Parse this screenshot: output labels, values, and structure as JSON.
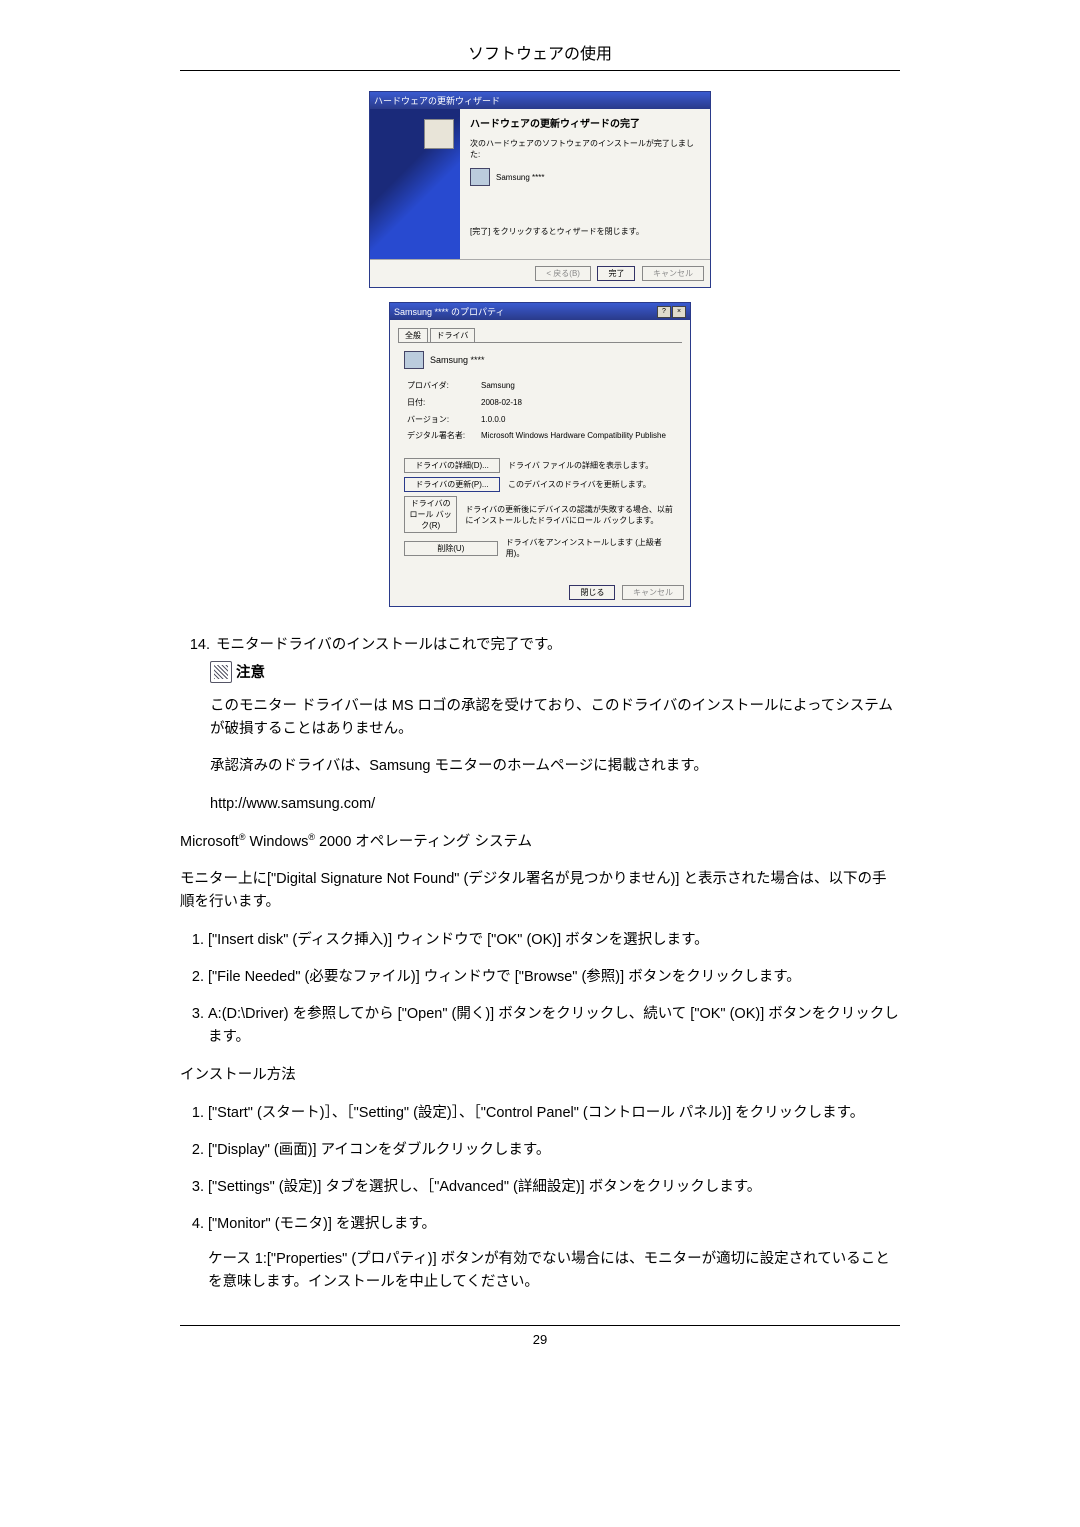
{
  "header": {
    "title": "ソフトウェアの使用"
  },
  "wizard": {
    "titlebar": "ハードウェアの更新ウィザード",
    "heading": "ハードウェアの更新ウィザードの完了",
    "sub": "次のハードウェアのソフトウェアのインストールが完了しました:",
    "device": "Samsung ****",
    "closehint": "[完了] をクリックするとウィザードを閉じます。",
    "buttons": {
      "back": "< 戻る(B)",
      "finish": "完了",
      "cancel": "キャンセル"
    }
  },
  "props": {
    "titlebar": "Samsung  ****   のプロパティ",
    "tabs": {
      "general": "全般",
      "driver": "ドライバ"
    },
    "device": "Samsung ****",
    "kv": {
      "provider_l": "プロバイダ:",
      "provider_v": "Samsung",
      "date_l": "日付:",
      "date_v": "2008-02-18",
      "ver_l": "バージョン:",
      "ver_v": "1.0.0.0",
      "sign_l": "デジタル署名者:",
      "sign_v": "Microsoft Windows Hardware Compatibility Publishe"
    },
    "btns": {
      "details": "ドライバの詳細(D)...",
      "details_d": "ドライバ ファイルの詳細を表示します。",
      "update": "ドライバの更新(P)...",
      "update_d": "このデバイスのドライバを更新します。",
      "rollback": "ドライバのロール バック(R)",
      "rollback_d": "ドライバの更新後にデバイスの認識が失敗する場合、以前にインストールしたドライバにロール バックします。",
      "uninstall": "削除(U)",
      "uninstall_d": "ドライバをアンインストールします (上級者用)。"
    },
    "footer": {
      "close": "閉じる",
      "cancel": "キャンセル"
    }
  },
  "doc": {
    "step14_num": "14.",
    "step14": "モニタードライバのインストールはこれで完了です。",
    "note_label": "注意",
    "p1": "このモニター ドライバーは MS ロゴの承認を受けており、このドライバのインストールによってシステムが破損することはありません。",
    "p2": "承認済みのドライバは、Samsung モニターのホームページに掲載されます。",
    "url": "http://www.samsung.com/",
    "os_prefix": "Microsoft",
    "os_mid": " Windows",
    "os_suffix": " 2000 オペレーティング システム",
    "p3": "モニター上に[\"Digital Signature Not Found\" (デジタル署名が見つかりません)] と表示された場合は、以下の手順を行います。",
    "dsnf": {
      "i1": "[\"Insert disk\" (ディスク挿入)] ウィンドウで [\"OK\" (OK)] ボタンを選択します。",
      "i2": "[\"File Needed\" (必要なファイル)] ウィンドウで [\"Browse\" (参照)] ボタンをクリックします。",
      "i3": "A:(D:\\Driver) を参照してから [\"Open\" (開く)] ボタンをクリックし、続いて [\"OK\" (OK)] ボタンをクリックします。"
    },
    "install_h": "インストール方法",
    "inst": {
      "i1": "[\"Start\" (スタート)］、［\"Setting\" (設定)］、［\"Control Panel\" (コントロール パネル)] をクリックします。",
      "i2": "[\"Display\" (画面)] アイコンをダブルクリックします。",
      "i3": "[\"Settings\" (設定)] タブを選択し、［\"Advanced\" (詳細設定)] ボタンをクリックします。",
      "i4": "[\"Monitor\" (モニタ)] を選択します。",
      "case1": "ケース 1:[\"Properties\" (プロパティ)] ボタンが有効でない場合には、モニターが適切に設定されていることを意味します。インストールを中止してください。"
    }
  },
  "page_number": "29"
}
